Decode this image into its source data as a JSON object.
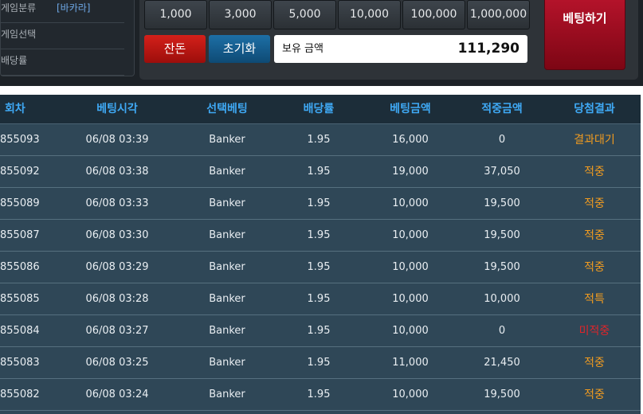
{
  "info": {
    "game_type_label": "게임분류",
    "game_type_value": "[바카라]",
    "game_select_label": "게임선택",
    "odds_label": "배당률"
  },
  "chips": [
    "1,000",
    "3,000",
    "5,000",
    "10,000",
    "100,000",
    "1,000,000"
  ],
  "controls": {
    "balance_button": "잔돈",
    "reset_button": "초기화",
    "holdings_label": "보유 금액",
    "holdings_value": "111,290",
    "bet_button": "베팅하기"
  },
  "table": {
    "headers": [
      "회차",
      "베팅시각",
      "선택베팅",
      "배당률",
      "베팅금액",
      "적중금액",
      "당첨결과"
    ],
    "rows": [
      {
        "round": "855093",
        "time": "06/08 03:39",
        "pick": "Banker",
        "odds": "1.95",
        "bet": "16,000",
        "win": "0",
        "result": "결과대기",
        "status": "wait"
      },
      {
        "round": "855092",
        "time": "06/08 03:38",
        "pick": "Banker",
        "odds": "1.95",
        "bet": "19,000",
        "win": "37,050",
        "result": "적중",
        "status": "hit"
      },
      {
        "round": "855089",
        "time": "06/08 03:33",
        "pick": "Banker",
        "odds": "1.95",
        "bet": "10,000",
        "win": "19,500",
        "result": "적중",
        "status": "hit"
      },
      {
        "round": "855087",
        "time": "06/08 03:30",
        "pick": "Banker",
        "odds": "1.95",
        "bet": "10,000",
        "win": "19,500",
        "result": "적중",
        "status": "hit"
      },
      {
        "round": "855086",
        "time": "06/08 03:29",
        "pick": "Banker",
        "odds": "1.95",
        "bet": "10,000",
        "win": "19,500",
        "result": "적중",
        "status": "hit"
      },
      {
        "round": "855085",
        "time": "06/08 03:28",
        "pick": "Banker",
        "odds": "1.95",
        "bet": "10,000",
        "win": "10,000",
        "result": "적특",
        "status": "hit"
      },
      {
        "round": "855084",
        "time": "06/08 03:27",
        "pick": "Banker",
        "odds": "1.95",
        "bet": "10,000",
        "win": "0",
        "result": "미적중",
        "status": "miss"
      },
      {
        "round": "855083",
        "time": "06/08 03:25",
        "pick": "Banker",
        "odds": "1.95",
        "bet": "11,000",
        "win": "21,450",
        "result": "적중",
        "status": "hit"
      },
      {
        "round": "855082",
        "time": "06/08 03:24",
        "pick": "Banker",
        "odds": "1.95",
        "bet": "10,000",
        "win": "19,500",
        "result": "적중",
        "status": "hit"
      }
    ]
  }
}
